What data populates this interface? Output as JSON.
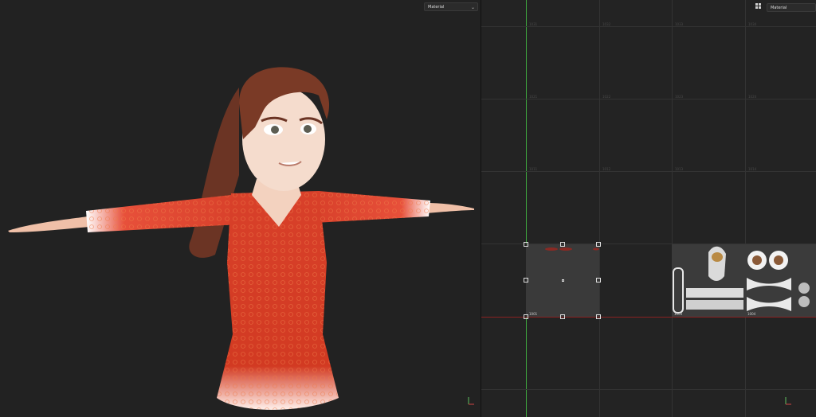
{
  "viewport_left": {
    "shading_dropdown": "Material",
    "axis_labels": {
      "y": "y",
      "x": "x"
    }
  },
  "viewport_uv": {
    "shading_dropdown": "Material",
    "grid_labels": [
      {
        "text": "1011"
      },
      {
        "text": "1012"
      },
      {
        "text": "1013"
      },
      {
        "text": "1014"
      },
      {
        "text": "1021"
      },
      {
        "text": "1022"
      },
      {
        "text": "1023"
      },
      {
        "text": "1024"
      },
      {
        "text": "1031"
      },
      {
        "text": "1032"
      },
      {
        "text": "1033"
      },
      {
        "text": "1034"
      }
    ],
    "tile_labels": {
      "t1": "1001",
      "t3": "1003",
      "t4": "1004"
    }
  },
  "colors": {
    "background": "#222222",
    "green_axis": "#3aa43a",
    "red_axis": "#a12a2a",
    "dress": "#d23b22"
  },
  "icons": [
    "chevron-down-icon",
    "grid-view-icon",
    "axis-gizmo-icon"
  ]
}
